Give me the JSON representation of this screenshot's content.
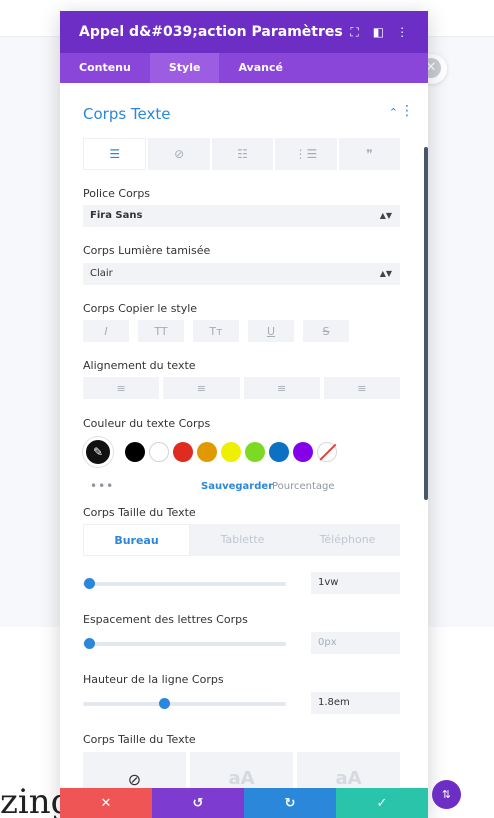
{
  "background": {
    "heading_fragment": "zing Coffee"
  },
  "modal": {
    "title": "Appel d&#039;action Paramètres",
    "header_icons": [
      "fullscreen-icon",
      "split-view-icon",
      "more-icon"
    ],
    "tabs": [
      {
        "label": "Contenu",
        "active": false
      },
      {
        "label": "Style",
        "active": true
      },
      {
        "label": "Avancé",
        "active": false
      }
    ]
  },
  "section": {
    "title": "Corps Texte",
    "text_toolbar": [
      "align-left-icon",
      "link-icon",
      "list-icon",
      "ordered-list-icon",
      "quote-icon"
    ]
  },
  "font": {
    "label": "Police Corps",
    "value": "Fira Sans"
  },
  "weight": {
    "label": "Corps Lumière tamisée",
    "value": "Clair"
  },
  "style": {
    "label": "Corps Copier le style",
    "buttons": [
      "I",
      "TT",
      "Tт",
      "U",
      "S"
    ]
  },
  "align": {
    "label": "Alignement du texte"
  },
  "color": {
    "label": "Couleur du texte Corps",
    "current": "#111111",
    "swatches": [
      "#000000",
      "#ffffff",
      "#e02b20",
      "#e09900",
      "#edf000",
      "#7cda24",
      "#0c71c3",
      "#8300e9"
    ],
    "save_label": "Sauvegarder",
    "percent_label": "Pourcentage",
    "more": "•••"
  },
  "text_size": {
    "label": "Corps Taille du Texte",
    "devices": [
      {
        "label": "Bureau",
        "active": true
      },
      {
        "label": "Tablette",
        "active": false
      },
      {
        "label": "Téléphone",
        "active": false
      }
    ],
    "value": "1vw",
    "slider_fraction": 0.03
  },
  "letter_spacing": {
    "label": "Espacement des lettres Corps",
    "value": "0px",
    "slider_fraction": 0.03
  },
  "line_height": {
    "label": "Hauteur de la ligne Corps",
    "value": "1.8em",
    "slider_fraction": 0.4
  },
  "text_size_2": {
    "label": "Corps Taille du Texte",
    "options": [
      "⃠",
      "aA",
      "aA"
    ]
  },
  "footer": {
    "cancel": "✕",
    "undo": "↺",
    "redo": "↻",
    "save": "✓",
    "colors": [
      "#ef5555",
      "#7d3bcf",
      "#2b87da",
      "#29c4a9"
    ]
  }
}
